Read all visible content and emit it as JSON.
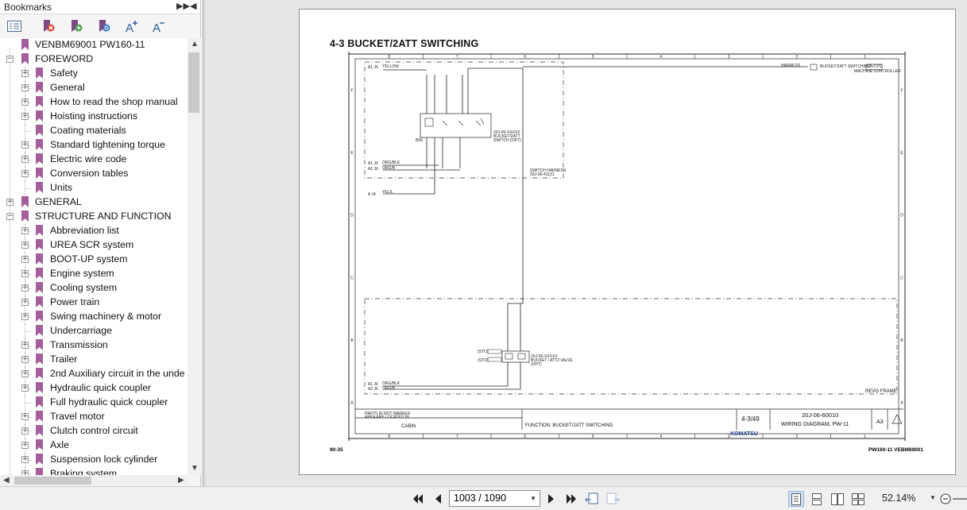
{
  "panel": {
    "title": "Bookmarks",
    "bookmarks": [
      {
        "label": "VENBM69001 PW160-11",
        "level": 0,
        "toggle": ""
      },
      {
        "label": "FOREWORD",
        "level": 0,
        "toggle": "−"
      },
      {
        "label": "Safety",
        "level": 1,
        "toggle": "+"
      },
      {
        "label": "General",
        "level": 1,
        "toggle": "+"
      },
      {
        "label": "How to read the shop manual",
        "level": 1,
        "toggle": "+"
      },
      {
        "label": "Hoisting instructions",
        "level": 1,
        "toggle": "+"
      },
      {
        "label": "Coating materials",
        "level": 1,
        "toggle": ""
      },
      {
        "label": "Standard tightening torque",
        "level": 1,
        "toggle": "+"
      },
      {
        "label": "Electric wire code",
        "level": 1,
        "toggle": "+"
      },
      {
        "label": "Conversion tables",
        "level": 1,
        "toggle": "+"
      },
      {
        "label": "Units",
        "level": 1,
        "toggle": ""
      },
      {
        "label": "GENERAL",
        "level": 0,
        "toggle": "+"
      },
      {
        "label": "STRUCTURE AND FUNCTION",
        "level": 0,
        "toggle": "−"
      },
      {
        "label": "Abbreviation list",
        "level": 1,
        "toggle": "+"
      },
      {
        "label": "UREA SCR system",
        "level": 1,
        "toggle": "+"
      },
      {
        "label": "BOOT-UP system",
        "level": 1,
        "toggle": "+"
      },
      {
        "label": "Engine system",
        "level": 1,
        "toggle": "+"
      },
      {
        "label": "Cooling system",
        "level": 1,
        "toggle": "+"
      },
      {
        "label": "Power train",
        "level": 1,
        "toggle": "+"
      },
      {
        "label": "Swing machinery & motor",
        "level": 1,
        "toggle": "+"
      },
      {
        "label": "Undercarriage",
        "level": 1,
        "toggle": ""
      },
      {
        "label": "Transmission",
        "level": 1,
        "toggle": "+"
      },
      {
        "label": "Trailer",
        "level": 1,
        "toggle": "+"
      },
      {
        "label": "2nd Auxiliary circuit in the unde",
        "level": 1,
        "toggle": "+"
      },
      {
        "label": "Hydraulic quick coupler",
        "level": 1,
        "toggle": "+"
      },
      {
        "label": "Full hydraulic quick coupler",
        "level": 1,
        "toggle": ""
      },
      {
        "label": "Travel motor",
        "level": 1,
        "toggle": "+"
      },
      {
        "label": "Clutch control circuit",
        "level": 1,
        "toggle": "+"
      },
      {
        "label": "Axle",
        "level": 1,
        "toggle": "+"
      },
      {
        "label": "Suspension lock cylinder",
        "level": 1,
        "toggle": "+"
      },
      {
        "label": "Braking system",
        "level": 1,
        "toggle": "+"
      }
    ]
  },
  "document": {
    "heading": "4-3 BUCKET/2ATT SWITCHING",
    "footer_left": "90-35",
    "footer_right": "PW160-11    VEBM69001",
    "drawing": {
      "column_numbers": [
        "8",
        "7",
        "6",
        "5",
        "4",
        "3",
        "2",
        "1"
      ],
      "row_letters": [
        "F",
        "E",
        "D",
        "C",
        "B",
        "A"
      ],
      "sheet": "4-3/49",
      "drawing_number": "20J-06-60010",
      "drawing_title": "WIRING DIAGRAM, PW-11",
      "size": "A3",
      "function": "FUNCTION: BUCKET/2ATT SWITCHING",
      "parts_location": "CABIN",
      "parts_note_1": "PARTS IN NOT MARKED",
      "parts_note_2": "AREA ARE LOCATED IN",
      "brand": "KOMATSU",
      "switch_name_1": "BUCKET/2ATT",
      "switch_name_2": "SWITCH (OPT)",
      "switch_code": "20J-06-XXXXX",
      "valve_name": "BUCKET / ATT2 VALVE",
      "valve_opt": "(OPT)",
      "harness": "SWITCH HARNESS",
      "revo_frame": "REVO FRAME",
      "machine_controller": "MACHINE CONTROLLER",
      "ctrl_signal": "BUCKET/2ATT SWITCHING",
      "sto_1": "(STO)",
      "sto_2": "(STO)"
    }
  },
  "nav": {
    "page_value": "1003 / 1090",
    "zoom": "52.14%"
  }
}
